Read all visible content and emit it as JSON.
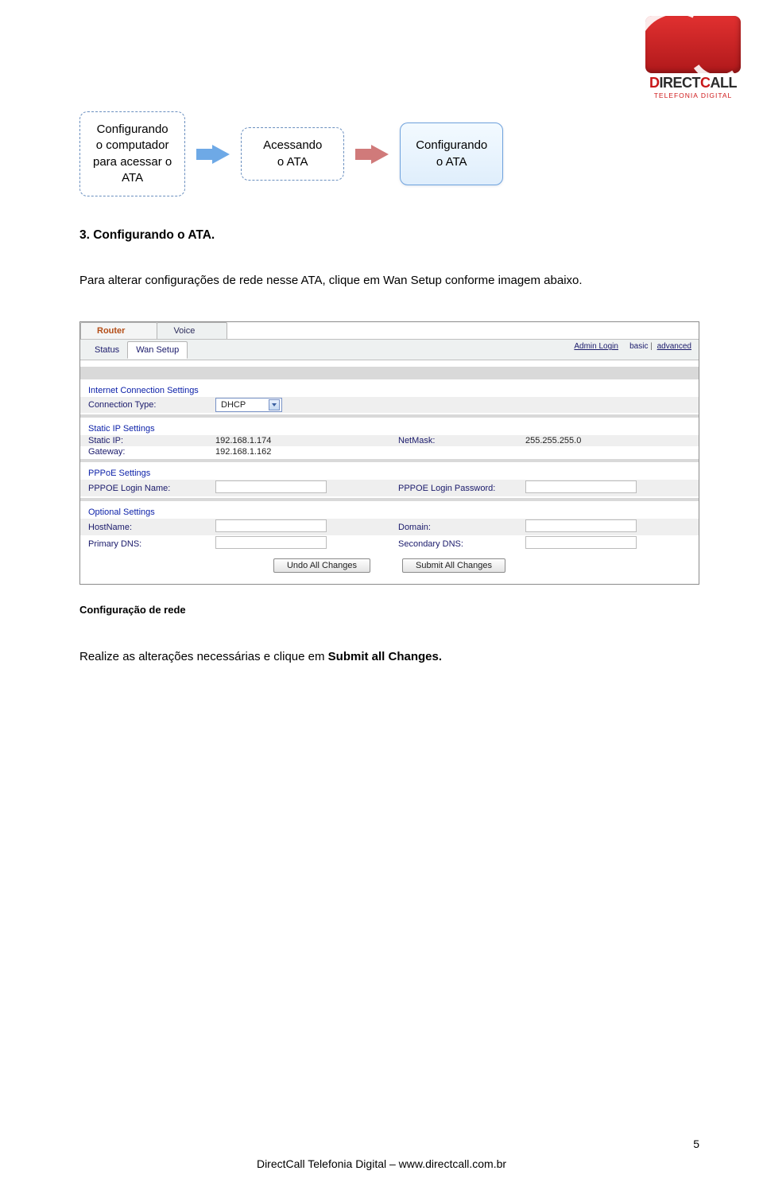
{
  "logo": {
    "brand_prefix": "D",
    "brand_rest_1": "IRECT",
    "brand_prefix_2": "C",
    "brand_rest_2": "ALL",
    "tagline": "TELEFONIA DIGITAL"
  },
  "flow": {
    "step1_line1": "Configurando",
    "step1_line2": "o computador",
    "step1_line3": "para acessar o",
    "step1_line4": "ATA",
    "step2_line1": "Acessando",
    "step2_line2": "o ATA",
    "step3_line1": "Configurando",
    "step3_line2": "o ATA"
  },
  "heading": "3.  Configurando o ATA.",
  "paragraph": "Para alterar configurações de rede nesse ATA, clique em Wan Setup conforme imagem abaixo.",
  "screenshot": {
    "tabs_top": {
      "router": "Router",
      "voice": "Voice"
    },
    "subtabs": {
      "status": "Status",
      "wan_setup": "Wan Setup"
    },
    "right_links": {
      "admin_login": "Admin Login",
      "basic": "basic",
      "advanced": "advanced",
      "sep": "|"
    },
    "sections": {
      "internet_conn": "Internet Connection Settings",
      "static_ip": "Static IP Settings",
      "pppoe": "PPPoE Settings",
      "optional": "Optional Settings"
    },
    "fields": {
      "connection_type_label": "Connection Type:",
      "connection_type_value": "DHCP",
      "static_ip_label": "Static IP:",
      "static_ip_value": "192.168.1.174",
      "netmask_label": "NetMask:",
      "netmask_value": "255.255.255.0",
      "gateway_label": "Gateway:",
      "gateway_value": "192.168.1.162",
      "pppoe_login_label": "PPPOE Login Name:",
      "pppoe_login_value": "",
      "pppoe_password_label": "PPPOE Login Password:",
      "pppoe_password_value": "",
      "hostname_label": "HostName:",
      "hostname_value": "",
      "domain_label": "Domain:",
      "domain_value": "",
      "primary_dns_label": "Primary DNS:",
      "primary_dns_value": "",
      "secondary_dns_label": "Secondary DNS:",
      "secondary_dns_value": ""
    },
    "buttons": {
      "undo": "Undo All Changes",
      "submit": "Submit All Changes"
    }
  },
  "caption": "Configuração de rede",
  "instruction_before": "Realize as alterações necessárias e clique em ",
  "instruction_bold": "Submit all Changes.",
  "footer": "DirectCall Telefonia Digital – www.directcall.com.br",
  "page_number": "5"
}
